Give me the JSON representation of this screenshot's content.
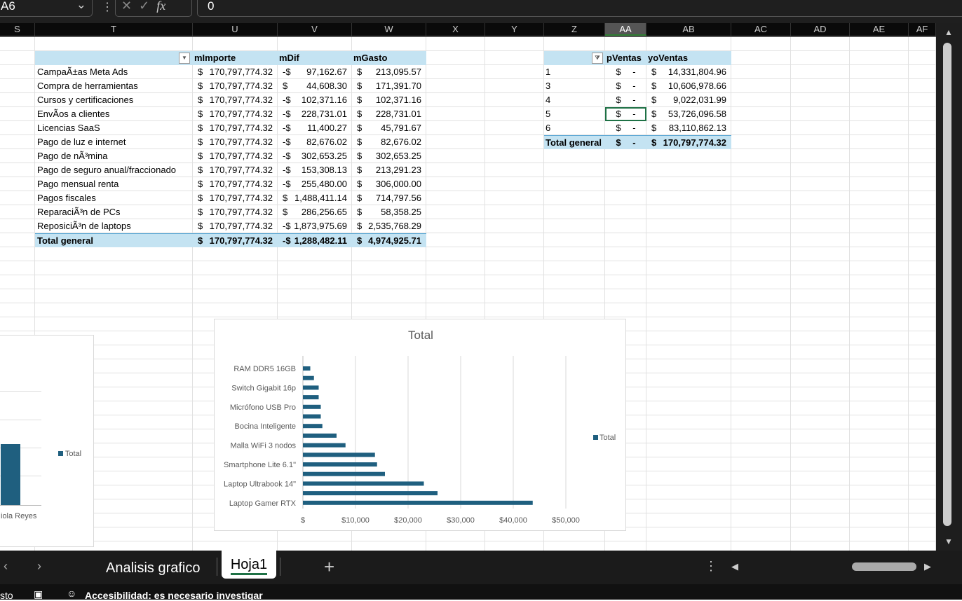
{
  "formula_bar": {
    "name_box": "A6",
    "formula": "0",
    "fx": "fx"
  },
  "columns": [
    {
      "l": "S",
      "w": 50
    },
    {
      "l": "T",
      "w": 225
    },
    {
      "l": "U",
      "w": 121
    },
    {
      "l": "V",
      "w": 106
    },
    {
      "l": "W",
      "w": 106
    },
    {
      "l": "X",
      "w": 84
    },
    {
      "l": "Y",
      "w": 84
    },
    {
      "l": "Z",
      "w": 87
    },
    {
      "l": "AA",
      "w": 59
    },
    {
      "l": "AB",
      "w": 121
    },
    {
      "l": "AC",
      "w": 85
    },
    {
      "l": "AD",
      "w": 84
    },
    {
      "l": "AE",
      "w": 84
    },
    {
      "l": "AF",
      "w": 39
    }
  ],
  "selected_column": "AA",
  "pivot1": {
    "headers": [
      "mImporte",
      "mDif",
      "mGasto"
    ],
    "rows": [
      [
        "CampaÃ±as Meta Ads",
        "$",
        "170,797,774.32",
        "-$",
        "97,162.67",
        "$",
        "213,095.57"
      ],
      [
        "Compra de herramientas",
        "$",
        "170,797,774.32",
        "$",
        "44,608.30",
        "$",
        "171,391.70"
      ],
      [
        "Cursos y certificaciones",
        "$",
        "170,797,774.32",
        "-$",
        "102,371.16",
        "$",
        "102,371.16"
      ],
      [
        "EnvÃ­os a clientes",
        "$",
        "170,797,774.32",
        "-$",
        "228,731.01",
        "$",
        "228,731.01"
      ],
      [
        "Licencias SaaS",
        "$",
        "170,797,774.32",
        "-$",
        "11,400.27",
        "$",
        "45,791.67"
      ],
      [
        "Pago de luz e internet",
        "$",
        "170,797,774.32",
        "-$",
        "82,676.02",
        "$",
        "82,676.02"
      ],
      [
        "Pago de nÃ³mina",
        "$",
        "170,797,774.32",
        "-$",
        "302,653.25",
        "$",
        "302,653.25"
      ],
      [
        "Pago de seguro anual/fraccionado",
        "$",
        "170,797,774.32",
        "-$",
        "153,308.13",
        "$",
        "213,291.23"
      ],
      [
        "Pago mensual renta",
        "$",
        "170,797,774.32",
        "-$",
        "255,480.00",
        "$",
        "306,000.00"
      ],
      [
        "Pagos fiscales",
        "$",
        "170,797,774.32",
        "$",
        "1,488,411.14",
        "$",
        "714,797.56"
      ],
      [
        "ReparaciÃ³n de PCs",
        "$",
        "170,797,774.32",
        "$",
        "286,256.65",
        "$",
        "58,358.25"
      ],
      [
        "ReposiciÃ³n de laptops",
        "$",
        "170,797,774.32",
        "-$",
        "1,873,975.69",
        "$",
        "2,535,768.29"
      ]
    ],
    "total": [
      "Total general",
      "$",
      "170,797,774.32",
      "-$",
      "1,288,482.11",
      "$",
      "4,974,925.71"
    ]
  },
  "pivot2": {
    "headers": [
      "pVentas",
      "yoVentas"
    ],
    "rows": [
      [
        "1",
        "$",
        "-",
        "$",
        "14,331,804.96"
      ],
      [
        "3",
        "$",
        "-",
        "$",
        "10,606,978.66"
      ],
      [
        "4",
        "$",
        "-",
        "$",
        "9,022,031.99"
      ],
      [
        "5",
        "$",
        "-",
        "$",
        "53,726,096.58"
      ],
      [
        "6",
        "$",
        "-",
        "$",
        "83,110,862.13"
      ]
    ],
    "total": [
      "Total general",
      "$",
      "-",
      "$",
      "170,797,774.32"
    ]
  },
  "chart_data": {
    "type": "bar",
    "orientation": "horizontal",
    "title": "Total",
    "categories": [
      "RAM DDR5 16GB",
      "",
      "Switch Gigabit 16p",
      "",
      "Micrófono USB Pro",
      "",
      "Bocina Inteligente",
      "",
      "Malla WiFi 3 nodos",
      "",
      "Smartphone Lite 6.1\"",
      "",
      "Laptop Ultrabook 14\"",
      "",
      "Laptop Gamer RTX"
    ],
    "values": [
      1400,
      2100,
      3000,
      3000,
      3400,
      3400,
      3700,
      6400,
      8100,
      13700,
      14100,
      15600,
      23000,
      25600,
      43700
    ],
    "xticks": [
      "$",
      "$10,000",
      "$20,000",
      "$30,000",
      "$40,000",
      "$50,000"
    ],
    "xlim": [
      0,
      50000
    ],
    "legend": "Total",
    "legend_position": "right",
    "color": "#1f5f7f"
  },
  "left_chart": {
    "legend": "Total",
    "xlabel": "iola Reyes"
  },
  "tabs": {
    "items": [
      "Analisis grafico",
      "Hoja1"
    ],
    "active": "Hoja1",
    "add": "+"
  },
  "status": {
    "left": "sto",
    "accessibility": "Accesibilidad: es necesario investigar"
  }
}
